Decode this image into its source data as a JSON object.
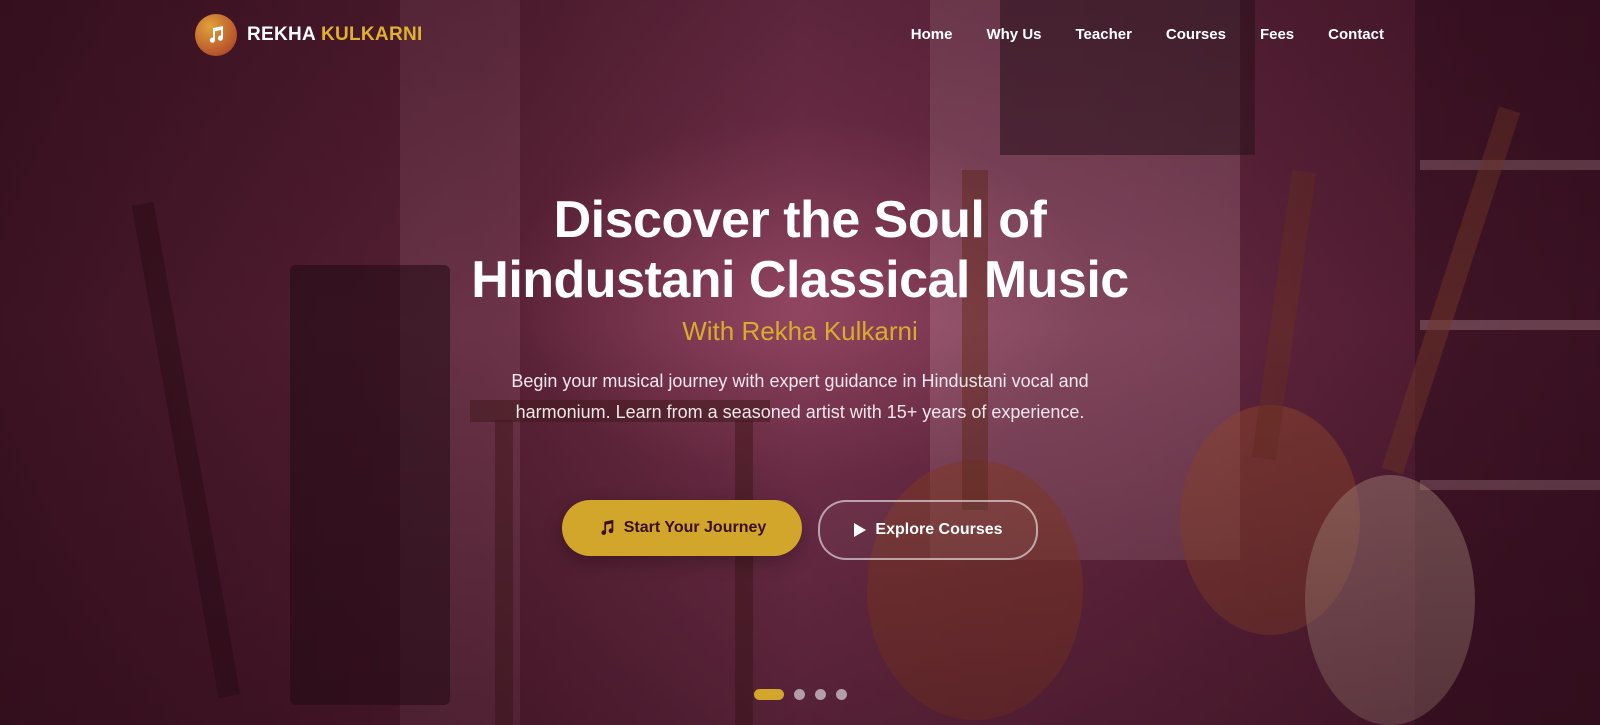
{
  "brand": {
    "name_first": "REKHA",
    "name_second": "KULKARNI",
    "icon": "music-note-icon"
  },
  "nav": {
    "items": [
      "Home",
      "Why Us",
      "Teacher",
      "Courses",
      "Fees",
      "Contact"
    ]
  },
  "hero": {
    "title_line1": "Discover the Soul of",
    "title_line2": "Hindustani Classical Music",
    "subtitle": "With Rekha Kulkarni",
    "description": "Begin your musical journey with expert guidance in Hindustani vocal and harmonium. Learn from a seasoned artist with 15+ years of experience.",
    "primary_button": {
      "label": "Start Your Journey",
      "icon": "music-note-icon"
    },
    "secondary_button": {
      "label": "Explore Courses",
      "icon": "play-icon"
    }
  },
  "carousel": {
    "slide_count": 4,
    "active_index": 0
  },
  "colors": {
    "accent": "#d2a52b",
    "overlay": "#5a2236",
    "text": "#ffffff"
  }
}
